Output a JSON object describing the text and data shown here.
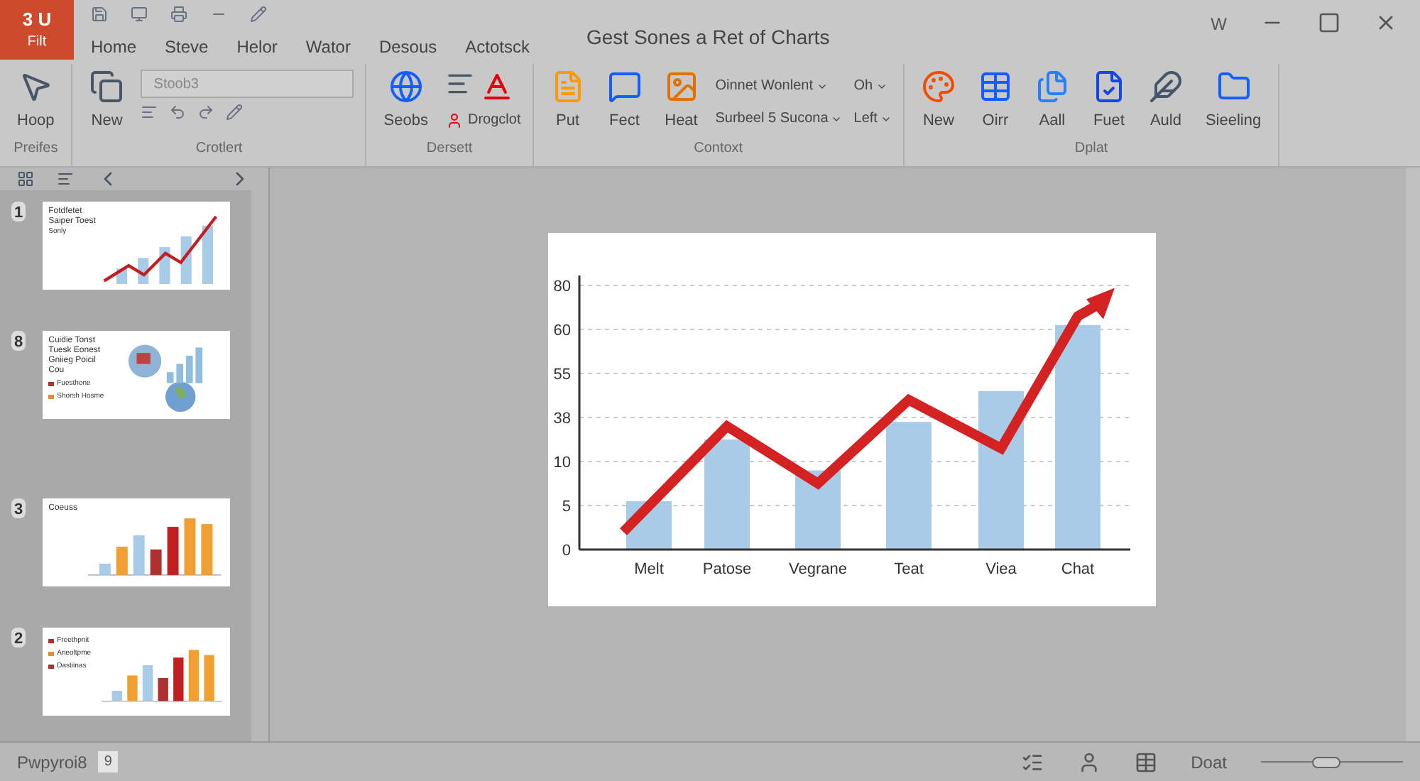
{
  "window": {
    "title": "Gest Sones a Ret of Charts",
    "app_badge": "W"
  },
  "file_tab": {
    "badge": "3 U",
    "label": "Filt"
  },
  "tabs": [
    "Home",
    "Steve",
    "Helor",
    "Wator",
    "Desous",
    "Actotsck"
  ],
  "ribbon": {
    "groups": [
      {
        "label": "Preifes",
        "buttons": [
          "Hoop"
        ]
      },
      {
        "label": "Crotlert",
        "buttons": [
          "New"
        ],
        "font_field": "Stoob3"
      },
      {
        "label": "Dersett",
        "buttons": [
          "Seobs"
        ],
        "dropdowns": [
          "Drogclot"
        ]
      },
      {
        "label": "Contoxt",
        "buttons": [
          "Put",
          "Fect",
          "Heat"
        ],
        "dropdowns": [
          "Oinnet Wonlent",
          "Oh",
          "Surbeel 5 Sucona",
          "Left"
        ]
      },
      {
        "label": "Dplat",
        "buttons": [
          "New",
          "Oirr",
          "Aall",
          "Fuet",
          "Auld",
          "Sieeling"
        ]
      }
    ]
  },
  "slides": [
    {
      "number": "1",
      "kind": "line",
      "title": [
        "Fotdfetet",
        "Saiper Toest"
      ],
      "subtitle": "Sonly"
    },
    {
      "number": "8",
      "kind": "globe",
      "title": [
        "Cuidie Tonst",
        "Tuesk Eonest",
        "Gniieg Poicil",
        "Cou"
      ],
      "legend": [
        "Fuesthone",
        "Shorsh Hosme"
      ]
    },
    {
      "number": "3",
      "kind": "bars",
      "title": [
        "Coeuss"
      ]
    },
    {
      "number": "2",
      "kind": "legend",
      "legend": [
        "Freethpnit",
        "Aneoltpme",
        "Dastiinas"
      ]
    }
  ],
  "slide_chart": {
    "x_labels": [
      "Melt",
      "Patose",
      "Vegrane",
      "Teat",
      "Viea",
      "Chat"
    ],
    "y_labels": [
      "80",
      "60",
      "55",
      "38",
      "10",
      "5",
      "0"
    ]
  },
  "status_bar": {
    "text": "Pwpyroi8",
    "badge": "9",
    "zoom_label": "Doat",
    "zoom": {
      "level": 0.45
    }
  }
}
